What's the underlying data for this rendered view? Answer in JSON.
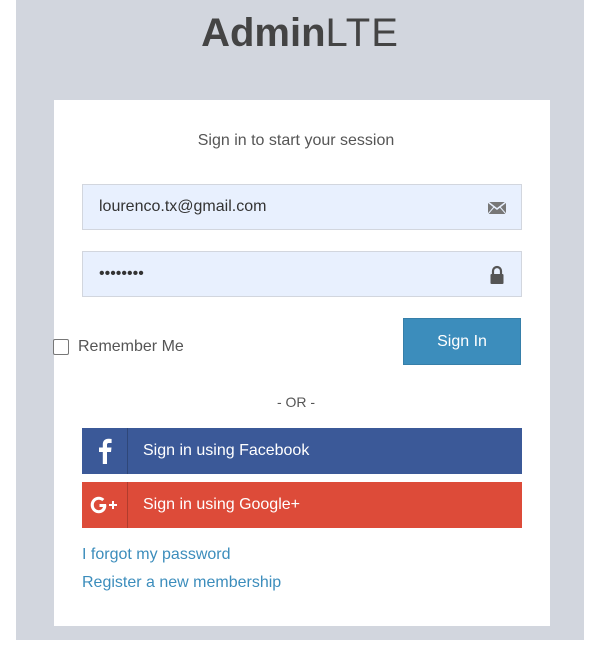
{
  "logo": {
    "bold": "Admin",
    "light": "LTE"
  },
  "login": {
    "message": "Sign in to start your session",
    "email": {
      "value": "lourenco.tx@gmail.com",
      "icon": "envelope-icon"
    },
    "password": {
      "value": "abcdefgh",
      "icon": "lock-icon"
    },
    "remember_label": "Remember Me",
    "remember_checked": false,
    "submit_label": "Sign In",
    "separator": "- OR -",
    "facebook_label": "Sign in using Facebook",
    "google_label": "Sign in using Google+",
    "forgot_link": "I forgot my password",
    "register_link": "Register a new membership"
  },
  "colors": {
    "background": "#d2d6de",
    "primary": "#3c8dbc",
    "facebook": "#3b5998",
    "google": "#dd4b39",
    "input_fill": "#e8f0fe"
  }
}
